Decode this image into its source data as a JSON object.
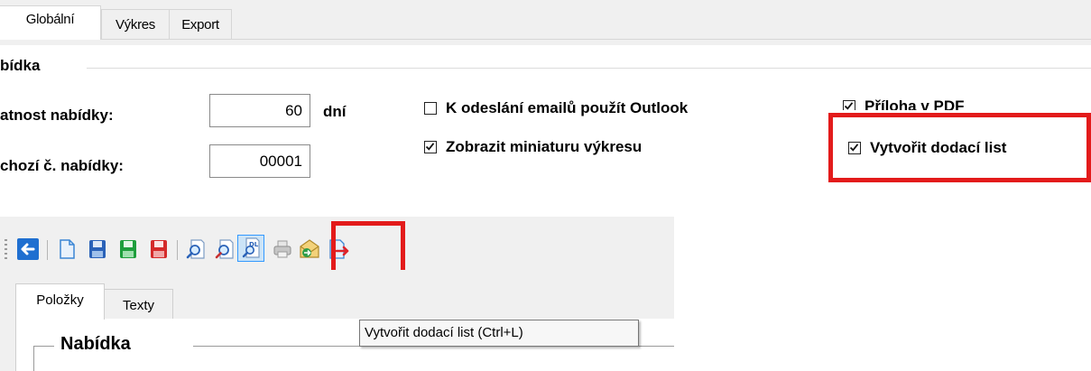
{
  "tabs": [
    "Globální",
    "Výkres",
    "Export"
  ],
  "group": {
    "title": "bídka"
  },
  "fields": {
    "validity": {
      "label": "atnost nabídky:",
      "value": "60",
      "unit": "dní"
    },
    "default_number": {
      "label": "chozí č. nabídky:",
      "value": "00001"
    }
  },
  "checkboxes": [
    {
      "label": "K odeslání emailů použít Outlook",
      "checked": false
    },
    {
      "label": "Zobrazit miniaturu výkresu",
      "checked": true
    },
    {
      "label": "Příloha v PDF",
      "checked": true
    },
    {
      "label": "Vytvořit dodací list",
      "checked": true
    }
  ],
  "toolbar_icons": [
    "back-icon",
    "new-document-icon",
    "save-blue-icon",
    "save-green-icon",
    "save-red-icon",
    "preview-icon",
    "preview-alt-icon",
    "delivery-note-icon",
    "printer-icon",
    "email-icon",
    "export-icon"
  ],
  "subtabs": [
    "Položky",
    "Texty"
  ],
  "inner_group": {
    "title": "Nabídka"
  },
  "tooltip": "Vytvořit dodací list (Ctrl+L)",
  "colors": {
    "highlight": "#e31b1b",
    "toolbar_blue": "#1f6fd0",
    "save_green": "#1e9e3c",
    "save_red": "#d42a2a"
  }
}
